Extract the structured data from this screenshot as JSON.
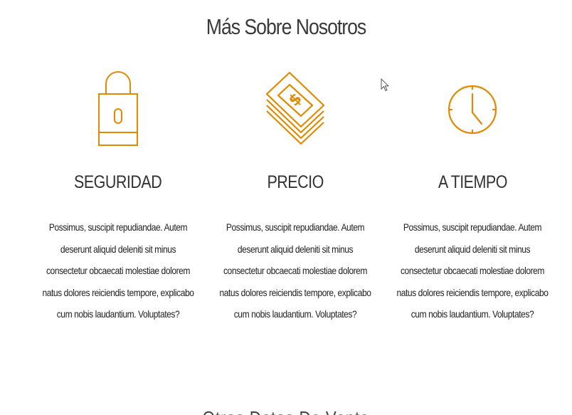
{
  "section": {
    "title": "Más Sobre Nosotros",
    "next_title": "Otros Datos De Venta"
  },
  "accent_color": "#e08a00",
  "features": [
    {
      "icon": "padlock-icon",
      "title": "SEGURIDAD",
      "lines": [
        "Possimus, suscipit repudiandae. Autem",
        "deserunt aliquid deleniti sit minus",
        "consectetur obcaecati molestiae dolorem",
        "natus dolores reiciendis tempore, explicabo",
        "cum nobis laudantium. Voluptates?"
      ]
    },
    {
      "icon": "money-stack-icon",
      "title": "PRECIO",
      "lines": [
        "Possimus, suscipit repudiandae. Autem",
        "deserunt aliquid deleniti sit minus",
        "consectetur obcaecati molestiae dolorem",
        "natus dolores reiciendis tempore, explicabo",
        "cum nobis laudantium. Voluptates?"
      ]
    },
    {
      "icon": "clock-icon",
      "title": "A TIEMPO",
      "lines": [
        "Possimus, suscipit repudiandae. Autem",
        "deserunt aliquid deleniti sit minus",
        "consectetur obcaecati molestiae dolorem",
        "natus dolores reiciendis tempore, explicabo",
        "cum nobis laudantium. Voluptates?"
      ]
    }
  ]
}
